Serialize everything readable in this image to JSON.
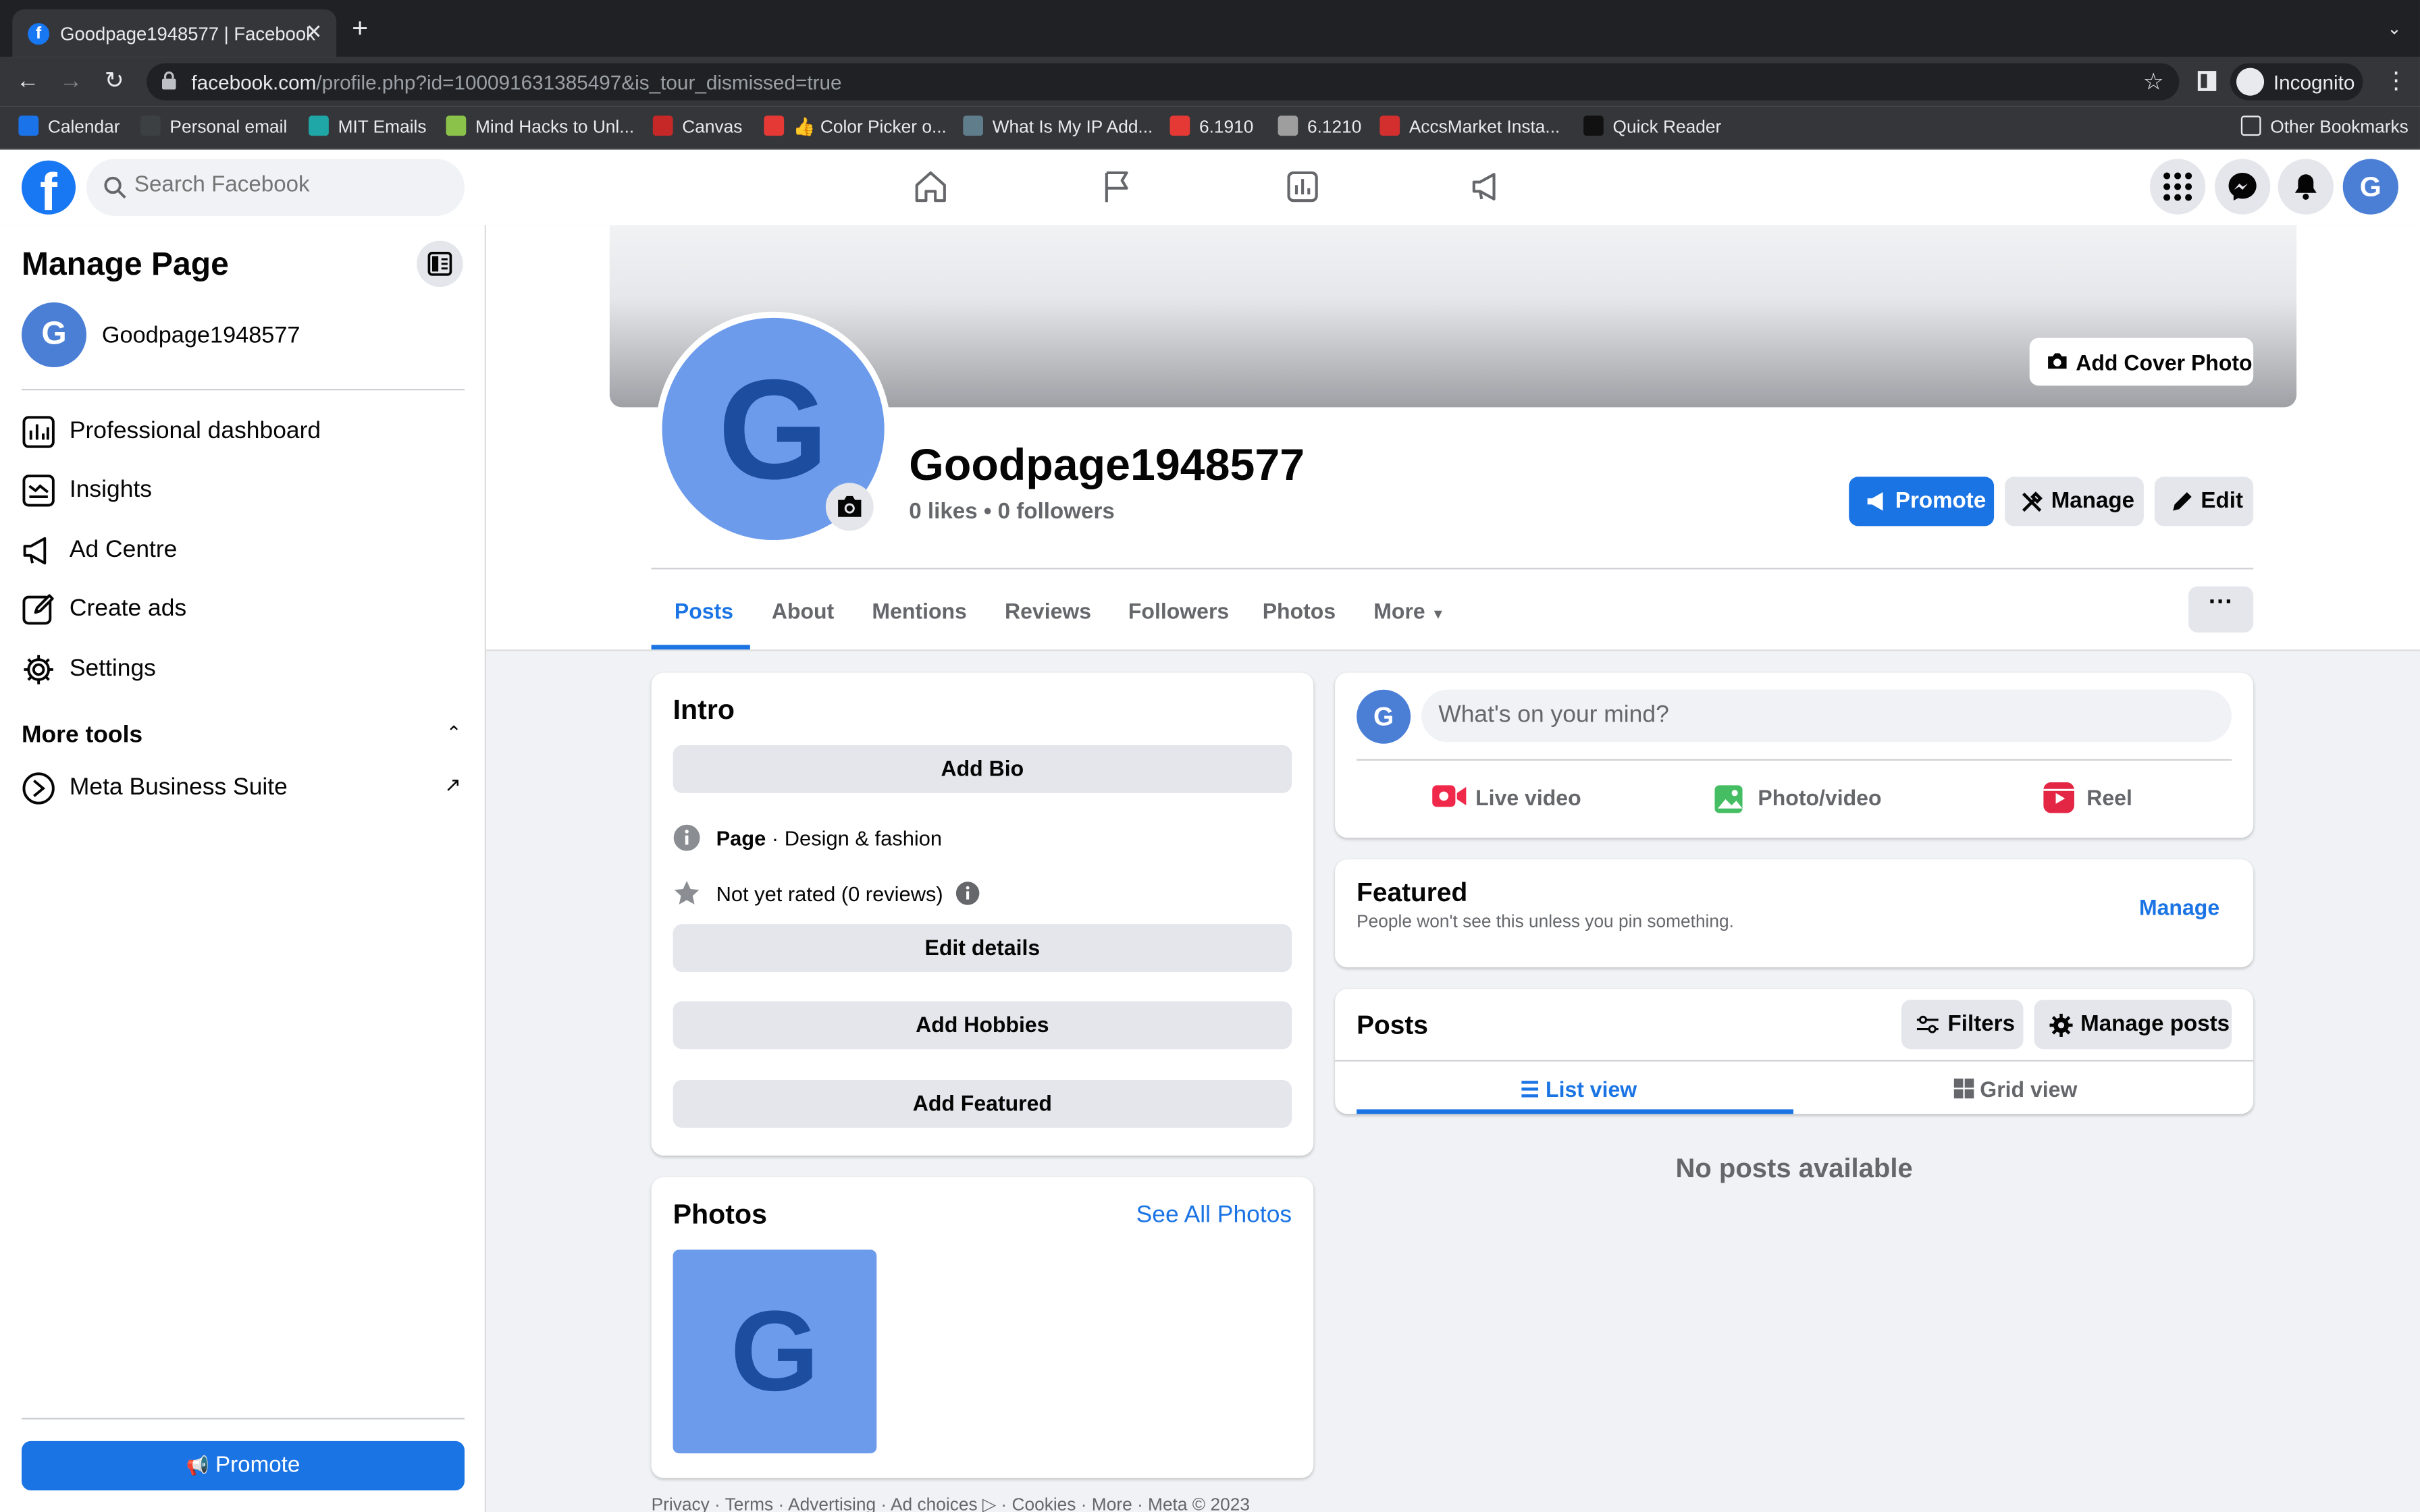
{
  "browser": {
    "tab_title": "Goodpage1948577 | Facebook",
    "url_domain": "facebook.com",
    "url_path": "/profile.php?id=100091631385497&is_tour_dismissed=true",
    "profile_label": "Incognito",
    "bookmarks": [
      {
        "label": "Calendar",
        "color": "#1a73e8"
      },
      {
        "label": "Personal email",
        "color": "#3c4043"
      },
      {
        "label": "MIT Emails",
        "color": "#1fa6a6"
      },
      {
        "label": "Mind Hacks to Unl...",
        "color": "#8bc34a"
      },
      {
        "label": "Canvas",
        "color": "#c62828"
      },
      {
        "label": "👍 Color Picker o...",
        "color": "#e53935"
      },
      {
        "label": "What Is My IP Add...",
        "color": "#607d8b"
      },
      {
        "label": "6.1910",
        "color": "#e53935"
      },
      {
        "label": "6.1210",
        "color": "#9e9e9e"
      },
      {
        "label": "AccsMarket Insta...",
        "color": "#d32f2f"
      },
      {
        "label": "Quick Reader",
        "color": "#111111"
      }
    ],
    "other_bookmarks": "Other Bookmarks"
  },
  "header": {
    "search_placeholder": "Search Facebook",
    "avatar_letter": "G"
  },
  "sidebar": {
    "title": "Manage Page",
    "page_name": "Goodpage1948577",
    "avatar_letter": "G",
    "items": [
      {
        "label": "Professional dashboard",
        "icon": "dashboard-icon"
      },
      {
        "label": "Insights",
        "icon": "insights-icon"
      },
      {
        "label": "Ad Centre",
        "icon": "megaphone-icon"
      },
      {
        "label": "Create ads",
        "icon": "edit-icon"
      },
      {
        "label": "Settings",
        "icon": "gear-icon"
      }
    ],
    "more_tools": "More tools",
    "tools": [
      {
        "label": "Meta Business Suite",
        "icon": "meta-business-icon"
      }
    ],
    "promote": "Promote"
  },
  "profile": {
    "add_cover": "Add Cover Photo",
    "avatar_letter": "G",
    "name": "Goodpage1948577",
    "stats": "0 likes • 0 followers",
    "actions": {
      "promote": "Promote",
      "manage": "Manage",
      "edit": "Edit"
    },
    "tabs": [
      "Posts",
      "About",
      "Mentions",
      "Reviews",
      "Followers",
      "Photos",
      "More"
    ],
    "more_dots": "···"
  },
  "intro": {
    "title": "Intro",
    "add_bio": "Add Bio",
    "category_bold": "Page",
    "category_rest": " · Design & fashion",
    "rating": "Not yet rated (0 reviews)",
    "edit_details": "Edit details",
    "add_hobbies": "Add Hobbies",
    "add_featured": "Add Featured"
  },
  "photos": {
    "title": "Photos",
    "see_all": "See All Photos",
    "thumb_letter": "G"
  },
  "composer": {
    "avatar_letter": "G",
    "placeholder": "What's on your mind?",
    "live": "Live video",
    "photo": "Photo/video",
    "reel": "Reel"
  },
  "featured": {
    "title": "Featured",
    "subtitle": "People won't see this unless you pin something.",
    "manage": "Manage"
  },
  "posts": {
    "title": "Posts",
    "filters": "Filters",
    "manage_posts": "Manage posts",
    "list_view": "List view",
    "grid_view": "Grid view",
    "empty": "No posts available"
  },
  "footer": "Privacy · Terms · Advertising · Ad choices ▷ · Cookies · More · Meta © 2023",
  "colors": {
    "brand": "#1877f2",
    "button_blue": "#1b74e4",
    "page_bg": "#f0f2f5"
  }
}
